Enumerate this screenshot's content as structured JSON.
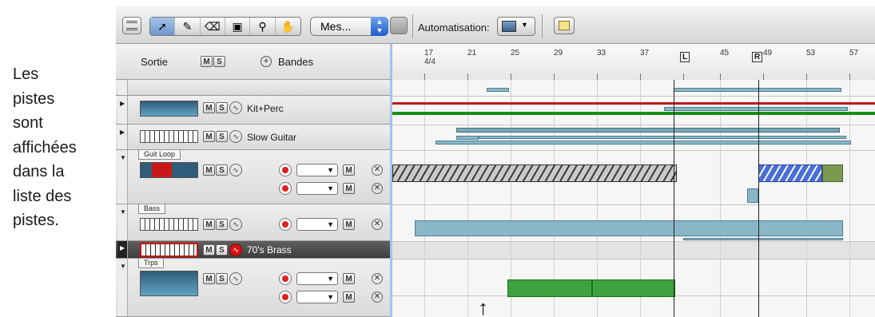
{
  "caption": {
    "lines": [
      "Les",
      "pistes",
      "sont",
      "affichées",
      "dans la",
      "liste des",
      "pistes."
    ]
  },
  "toolbar": {
    "tools": [
      {
        "name": "pointer-tool-icon",
        "glyph": "➚"
      },
      {
        "name": "pencil-tool-icon",
        "glyph": "✎"
      },
      {
        "name": "eraser-tool-icon",
        "glyph": "⌫"
      },
      {
        "name": "marquee-tool-icon",
        "glyph": "▣"
      },
      {
        "name": "zoom-tool-icon",
        "glyph": "🔍"
      },
      {
        "name": "hand-tool-icon",
        "glyph": "✋"
      }
    ],
    "snap_value": "Mes...",
    "automation_label": "Automatisation:"
  },
  "list_header": {
    "sortie": "Sortie",
    "m": "M",
    "s": "S",
    "bandes": "Bandes"
  },
  "tracks": [
    {
      "name": "Kit+Perc",
      "m": "M",
      "s": "S"
    },
    {
      "name": "Slow Guitar",
      "m": "M",
      "s": "S"
    },
    {
      "name": "Guit Loop",
      "m": "M",
      "s": "S"
    },
    {
      "name": "Bass",
      "m": "M",
      "s": "S"
    },
    {
      "name": "70's Brass",
      "m": "M",
      "s": "S"
    },
    {
      "name": "Trps",
      "m": "M",
      "s": "S"
    }
  ],
  "ruler": {
    "bars": [
      "17",
      "21",
      "25",
      "29",
      "33",
      "37",
      "L",
      "45",
      "R",
      "49",
      "53",
      "57"
    ],
    "signature": "4/4"
  },
  "colors": {
    "selection_accent": "#a7c2e3",
    "region_blue": "#8ab7c8",
    "region_green": "#3ea33e",
    "record_red": "#e02020"
  }
}
